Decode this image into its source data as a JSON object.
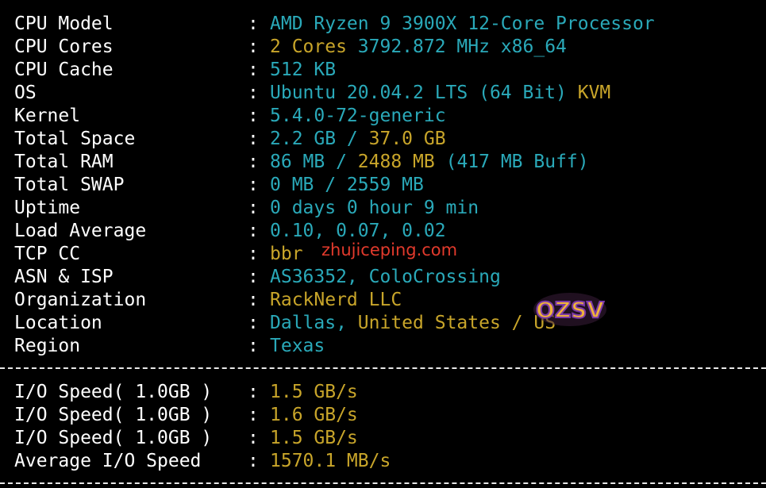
{
  "sysinfo": {
    "separator": ":",
    "rows": [
      {
        "key": "CPU Model",
        "val": "AMD Ryzen 9 3900X 12-Core Processor"
      },
      {
        "key": "CPU Cores",
        "val_a": "2 Cores",
        "val_b": "3792.872 MHz x86_64"
      },
      {
        "key": "CPU Cache",
        "val": "512 KB"
      },
      {
        "key": "OS",
        "val_a": "Ubuntu 20.04.2 LTS (64 Bit)",
        "val_b": "KVM"
      },
      {
        "key": "Kernel",
        "val": "5.4.0-72-generic"
      },
      {
        "key": "Total Space",
        "val_a": "2.2 GB /",
        "val_b": "37.0 GB"
      },
      {
        "key": "Total RAM",
        "val_a": "86 MB /",
        "val_b": "2488 MB",
        "val_c": "(417 MB Buff)"
      },
      {
        "key": "Total SWAP",
        "val": "0 MB / 2559 MB"
      },
      {
        "key": "Uptime",
        "val": "0 days 0 hour 9 min"
      },
      {
        "key": "Load Average",
        "val": "0.10, 0.07, 0.02"
      },
      {
        "key": "TCP CC",
        "val": "bbr"
      },
      {
        "key": "ASN & ISP",
        "val": "AS36352, ColoCrossing"
      },
      {
        "key": "Organization",
        "val": "RackNerd LLC"
      },
      {
        "key": "Location",
        "val_a": "Dallas,",
        "val_b": "United States /",
        "val_c": "US"
      },
      {
        "key": "Region",
        "val": "Texas"
      }
    ]
  },
  "io": {
    "rows": [
      {
        "key": "I/O Speed( 1.0GB )",
        "val": "1.5 GB/s"
      },
      {
        "key": "I/O Speed( 1.0GB )",
        "val": "1.6 GB/s"
      },
      {
        "key": "I/O Speed( 1.0GB )",
        "val": "1.5 GB/s"
      },
      {
        "key": "Average I/O Speed",
        "val": "1570.1 MB/s"
      }
    ]
  },
  "watermark": {
    "text": "zhujiceping.com",
    "logo_text": "OZSV"
  },
  "colors": {
    "background": "#000000",
    "label": "#ffffff",
    "cyan": "#2aa9b9",
    "yellow": "#c8a52a",
    "watermark": "#e23a2c"
  }
}
